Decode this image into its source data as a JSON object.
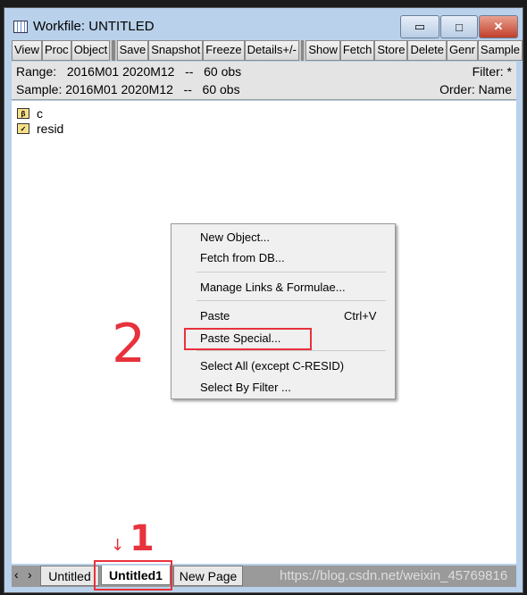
{
  "window": {
    "title": "Workfile: UNTITLED",
    "minimize": "▭",
    "maximize": "□",
    "close": "✕"
  },
  "toolbar": {
    "group1": [
      "View",
      "Proc",
      "Object"
    ],
    "group2": [
      "Save",
      "Snapshot",
      "Freeze",
      "Details+/-"
    ],
    "group3": [
      "Show",
      "Fetch",
      "Store",
      "Delete",
      "Genr",
      "Sample"
    ]
  },
  "info": {
    "range": "Range:   2016M01 2020M12   --   60 obs",
    "sample": "Sample: 2016M01 2020M12   --   60 obs",
    "filter": "Filter: *",
    "order": "Order: Name"
  },
  "objects": [
    {
      "name": "c",
      "icon": "coefficient-icon",
      "glyph": "β"
    },
    {
      "name": "resid",
      "icon": "series-icon",
      "glyph": "✓"
    }
  ],
  "context_menu": {
    "items": [
      {
        "label": "New Object..."
      },
      {
        "label": "Fetch from DB..."
      },
      {
        "label": "Manage Links & Formulae..."
      },
      {
        "label": "Paste",
        "shortcut": "Ctrl+V"
      },
      {
        "label": "Paste Special..."
      },
      {
        "label": "Select All (except C-RESID)"
      },
      {
        "label": "Select By Filter ..."
      }
    ]
  },
  "tabs": {
    "scroll_left": "‹",
    "scroll_right": "›",
    "items": [
      "Untitled",
      "Untitled1",
      "New Page"
    ],
    "active": "Untitled1"
  },
  "watermark": "https://blog.csdn.net/weixin_45769816",
  "annotations": {
    "one": "1",
    "two": "2",
    "arrow": "↓",
    "color": "#e8323c"
  }
}
